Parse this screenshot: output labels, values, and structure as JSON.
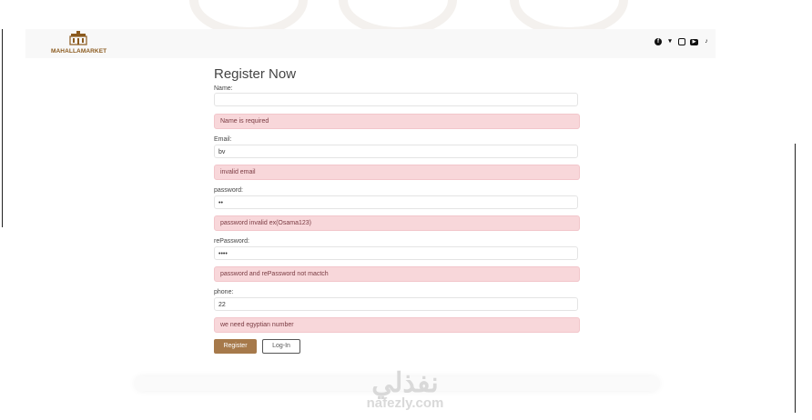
{
  "header": {
    "brand_text": "MAHALLAMARKET",
    "social_icons": [
      "facebook-icon",
      "twitter-icon",
      "instagram-icon",
      "youtube-icon",
      "tiktok-icon"
    ]
  },
  "form": {
    "title": "Register Now",
    "name": {
      "label": "Name:",
      "value": "",
      "error": "Name is required"
    },
    "email": {
      "label": "Email:",
      "value": "bv",
      "error": "invalid email"
    },
    "password": {
      "label": "password:",
      "value": "••",
      "error": "password invalid ex(Osama123)"
    },
    "repassword": {
      "label": "rePassword:",
      "value": "••••",
      "error": "password and rePassword not mactch"
    },
    "phone": {
      "label": "phone:",
      "value": "22",
      "error": "we need egyptian number"
    },
    "register_label": "Register",
    "login_label": "Log-In"
  },
  "watermark": {
    "arabic": "نفذلي",
    "latin": "nafezly.com"
  },
  "colors": {
    "accent": "#a6794a",
    "error_bg": "#f8d7da",
    "brand": "#8b5a1e"
  }
}
